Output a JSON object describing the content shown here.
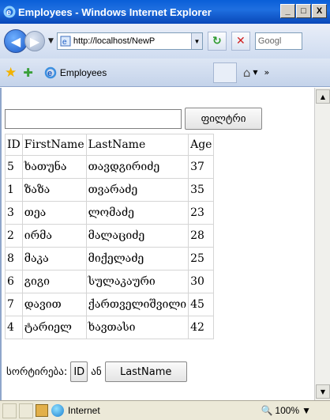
{
  "window": {
    "title": "Employees - Windows Internet Explorer",
    "minimize": "_",
    "maximize": "□",
    "close": "X"
  },
  "nav": {
    "url": "http://localhost/NewP",
    "search_placeholder": "Googl"
  },
  "tab": {
    "label": "Employees"
  },
  "page": {
    "filter_value": "",
    "filter_button": "ფილტრი",
    "table": {
      "headers": [
        "ID",
        "FirstName",
        "LastName",
        "Age"
      ],
      "rows": [
        [
          "5",
          "ხათუნა",
          "თავდგირიძე",
          "37"
        ],
        [
          "1",
          "ზაზა",
          "თვარაძე",
          "35"
        ],
        [
          "3",
          "თეა",
          "ლომაძე",
          "23"
        ],
        [
          "2",
          "ირმა",
          "მალაციძე",
          "28"
        ],
        [
          "8",
          "მაკა",
          "მიქელაძე",
          "25"
        ],
        [
          "6",
          "გიგი",
          "სულაკაური",
          "30"
        ],
        [
          "7",
          "დავით",
          "ქართველიშვილი",
          "45"
        ],
        [
          "4",
          "ტარიელ",
          "ხავთასი",
          "42"
        ]
      ]
    },
    "sort_label": "სორტირება:",
    "sort_id_button": "ID",
    "sort_or": "ან",
    "sort_lastname_button": "LastName"
  },
  "status": {
    "zone": "Internet",
    "zoom": "100%"
  },
  "colors": {
    "titlebar": "#0a5fd8",
    "chrome": "#cfdcf0",
    "statusbar": "#ece9d8"
  }
}
